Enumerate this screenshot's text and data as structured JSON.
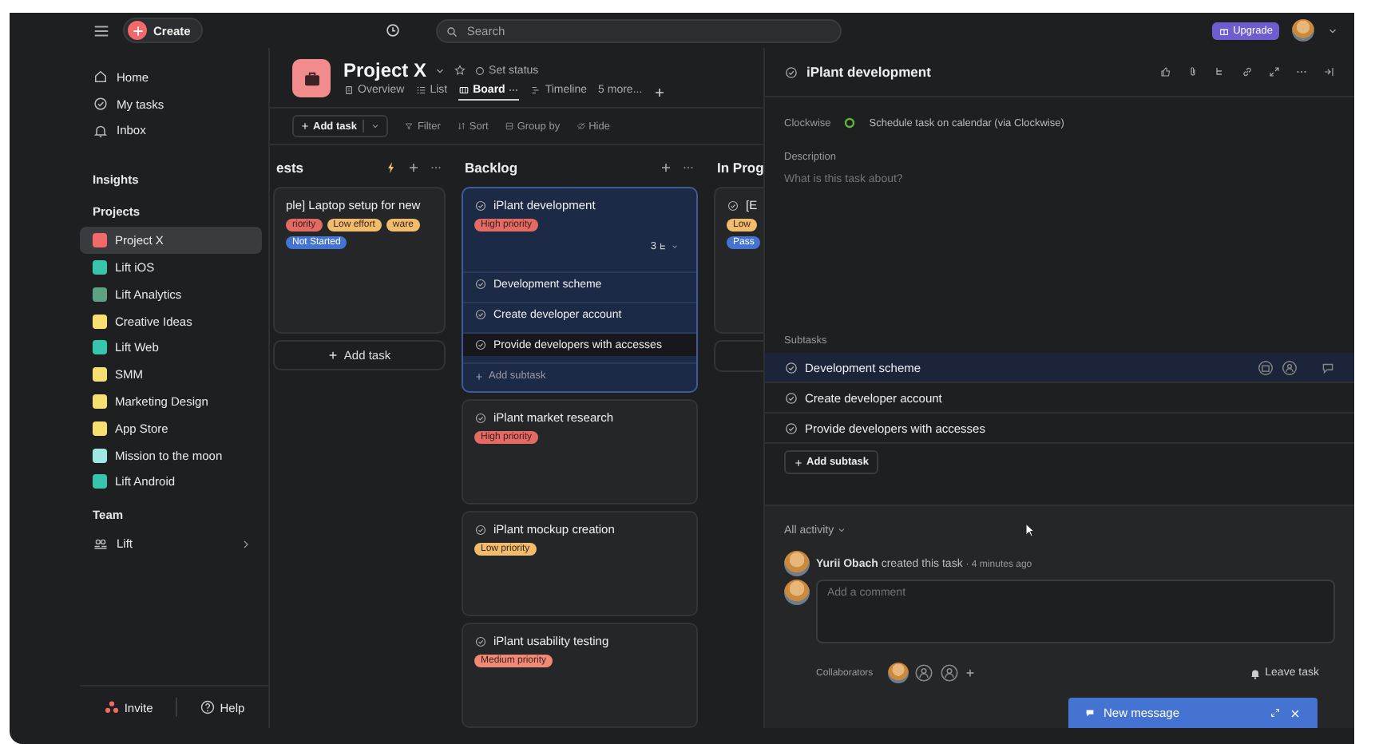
{
  "topbar": {
    "create": "Create",
    "search_placeholder": "Search",
    "upgrade": "Upgrade"
  },
  "sidebar": {
    "nav": [
      {
        "label": "Home",
        "kind": "home"
      },
      {
        "label": "My tasks",
        "kind": "check"
      },
      {
        "label": "Inbox",
        "kind": "bell"
      }
    ],
    "insights": "Insights",
    "projects_heading": "Projects",
    "projects": [
      {
        "label": "Project X",
        "color": "#f06a6a",
        "selected": true
      },
      {
        "label": "Lift iOS",
        "color": "#37c5ab",
        "selected": false
      },
      {
        "label": "Lift Analytics",
        "color": "#5da283",
        "selected": false
      },
      {
        "label": "Creative Ideas",
        "color": "#f8df72",
        "selected": false
      },
      {
        "label": "Lift Web",
        "color": "#37c5ab",
        "selected": false
      },
      {
        "label": "SMM",
        "color": "#f8df72",
        "selected": false
      },
      {
        "label": "Marketing Design",
        "color": "#f8df72",
        "selected": false
      },
      {
        "label": "App Store",
        "color": "#f8df72",
        "selected": false
      },
      {
        "label": "Mission to the moon",
        "color": "#9ee7e3",
        "selected": false
      },
      {
        "label": "Lift Android",
        "color": "#37c5ab",
        "selected": false
      }
    ],
    "team_heading": "Team",
    "team": [
      {
        "label": "Lift"
      }
    ],
    "invite": "Invite",
    "help": "Help"
  },
  "project": {
    "name": "Project X",
    "set_status": "Set status",
    "tabs": [
      {
        "label": "Overview",
        "kind": "doc",
        "selected": false
      },
      {
        "label": "List",
        "kind": "list",
        "selected": false
      },
      {
        "label": "Board",
        "kind": "board",
        "selected": true
      },
      {
        "label": "Timeline",
        "kind": "timeline",
        "selected": false
      },
      {
        "label": "5 more...",
        "kind": "more",
        "selected": false
      }
    ],
    "add_task": "Add task",
    "actions": [
      {
        "label": "Filter",
        "kind": "filter"
      },
      {
        "label": "Sort",
        "kind": "sort"
      },
      {
        "label": "Group by",
        "kind": "group"
      },
      {
        "label": "Hide",
        "kind": "hide"
      }
    ]
  },
  "board": {
    "columns": [
      {
        "title": "ests",
        "kind": "partial",
        "cards": [
          {
            "title": "ple] Laptop setup for new",
            "selected": false,
            "tags": [
              {
                "label": "riority",
                "color": "#e36b63"
              },
              {
                "label": "Low effort",
                "color": "#f1bd6c"
              },
              {
                "label": "ware",
                "color": "#f1bd6c"
              },
              {
                "label": "Not Started",
                "color": "#4573d2"
              }
            ]
          }
        ],
        "add_task": "Add task"
      },
      {
        "title": "Backlog",
        "kind": "full",
        "cards": [
          {
            "title": "iPlant development",
            "selected": true,
            "tags": [
              {
                "label": "High priority",
                "color": "#e36b63"
              }
            ],
            "subtask_count": "3",
            "subtasks": [
              {
                "label": "Development scheme",
                "selected": false
              },
              {
                "label": "Create developer account",
                "selected": false
              },
              {
                "label": "Provide developers with accesses",
                "selected": true
              }
            ],
            "add_subtask": "Add subtask"
          },
          {
            "title": "iPlant market research",
            "selected": false,
            "tags": [
              {
                "label": "High priority",
                "color": "#e36b63"
              }
            ]
          },
          {
            "title": "iPlant mockup creation",
            "selected": false,
            "tags": [
              {
                "label": "Low priority",
                "color": "#f1bd6c"
              }
            ]
          },
          {
            "title": "iPlant usability testing",
            "selected": false,
            "tags": [
              {
                "label": "Medium priority",
                "color": "#f08a75"
              }
            ]
          }
        ]
      },
      {
        "title": "In Prog",
        "kind": "partial",
        "cards": [
          {
            "title": "[E",
            "selected": false,
            "tags": [
              {
                "label": "Low",
                "color": "#f1bd6c"
              },
              {
                "label": "Pass",
                "color": "#4573d2"
              }
            ]
          }
        ]
      }
    ]
  },
  "detail": {
    "title": "iPlant development",
    "clockwise_label": "Clockwise",
    "clockwise_value": "Schedule task on calendar (via Clockwise)",
    "description_label": "Description",
    "description_placeholder": "What is this task about?",
    "subtasks_label": "Subtasks",
    "subtasks": [
      {
        "label": "Development scheme",
        "selected": true
      },
      {
        "label": "Create developer account",
        "selected": false
      },
      {
        "label": "Provide developers with accesses",
        "selected": false
      }
    ],
    "add_subtask": "Add subtask",
    "activity_filter": "All activity",
    "activity": [
      {
        "author": "Yurii Obach",
        "text": "created this task",
        "time": "· 4 minutes ago"
      }
    ],
    "comment_placeholder": "Add a comment",
    "collaborators_label": "Collaborators",
    "leave_task": "Leave task",
    "new_message": "New message"
  }
}
